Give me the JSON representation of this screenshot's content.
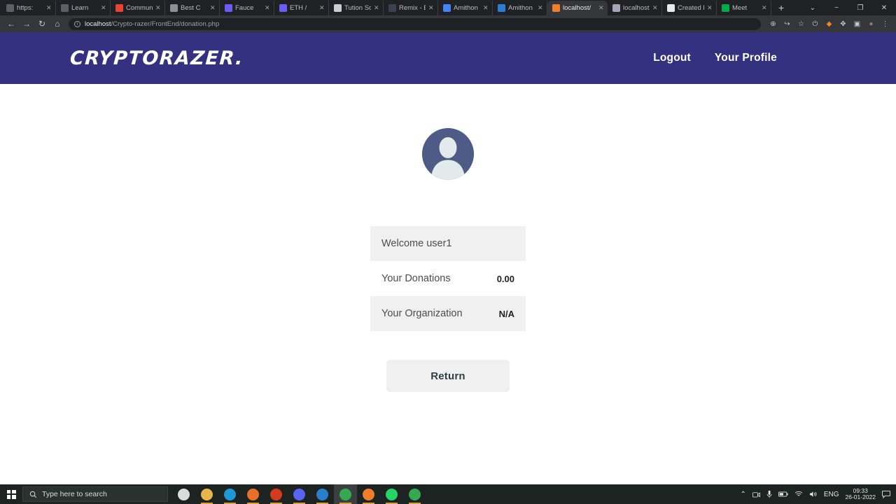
{
  "browser": {
    "tabs": [
      {
        "title": "https:",
        "favicon": "accessibility-icon",
        "color": "#5b6068",
        "active": false
      },
      {
        "title": "Learn",
        "favicon": "accessibility-icon",
        "color": "#5b6068",
        "active": false
      },
      {
        "title": "Communi",
        "favicon": "gmail-icon",
        "color": "#ea4335",
        "active": false
      },
      {
        "title": "Best C",
        "favicon": "metamask-icon",
        "color": "#8a8f98",
        "active": false
      },
      {
        "title": "Fauce",
        "favicon": "ethereum-icon",
        "color": "#6b5cf6",
        "active": false
      },
      {
        "title": "ETH /",
        "favicon": "ethereum-icon",
        "color": "#6b5cf6",
        "active": false
      },
      {
        "title": "Tution Sc",
        "favicon": "shield-icon",
        "color": "#c9cdd4",
        "active": false
      },
      {
        "title": "Remix - E",
        "favicon": "remix-icon",
        "color": "#3b4252",
        "active": false
      },
      {
        "title": "Amithon",
        "favicon": "docs-icon",
        "color": "#4285f4",
        "active": false
      },
      {
        "title": "Amithon",
        "favicon": "drive-doc-icon",
        "color": "#2b7cd3",
        "active": false
      },
      {
        "title": "localhost/",
        "favicon": "xampp-icon",
        "color": "#f07d2c",
        "active": true
      },
      {
        "title": "localhost",
        "favicon": "mysql-icon",
        "color": "#a9a2b8",
        "active": false
      },
      {
        "title": "Created F",
        "favicon": "github-icon",
        "color": "#e8eaed",
        "active": false
      },
      {
        "title": "Meet",
        "favicon": "meet-icon",
        "color": "#00ac47",
        "active": false
      }
    ],
    "new_tab_label": "+",
    "window_controls": [
      "⌄",
      "−",
      "❐",
      "✕"
    ],
    "nav": {
      "back": "←",
      "forward": "→",
      "reload": "↻",
      "home": "⌂"
    },
    "omnibox": {
      "site_info_icon": "info-icon",
      "url_host": "localhost",
      "url_path": "/Crypto-razer/FrontEnd/donation.php",
      "full_url": "localhost/Crypto-razer/FrontEnd/donation.php"
    },
    "toolbar_icons": [
      {
        "name": "zoom-icon",
        "glyph": "⊕"
      },
      {
        "name": "share-icon",
        "glyph": "↪"
      },
      {
        "name": "bookmark-star-icon",
        "glyph": "☆"
      },
      {
        "name": "power-extension-icon",
        "glyph": "⏻"
      },
      {
        "name": "metamask-extension-icon",
        "glyph": "◆"
      },
      {
        "name": "extensions-puzzle-icon",
        "glyph": "✥"
      },
      {
        "name": "sidebar-icon",
        "glyph": "▣"
      },
      {
        "name": "profile-avatar-icon",
        "glyph": "●"
      },
      {
        "name": "chrome-menu-icon",
        "glyph": "⋮"
      }
    ]
  },
  "site": {
    "brand": "CRYPTORAZER.",
    "header_bg": "#333180",
    "nav": [
      {
        "label": "Logout"
      },
      {
        "label": "Your Profile"
      }
    ]
  },
  "profile": {
    "avatar_alt": "user-avatar",
    "rows": [
      {
        "label": "Welcome user1",
        "value": "",
        "shaded": true
      },
      {
        "label": "Your Donations",
        "value": "0.00",
        "shaded": false
      },
      {
        "label": "Your Organization",
        "value": "N/A",
        "shaded": true
      }
    ],
    "return_button": "Return"
  },
  "taskbar": {
    "start_icon": "windows-start-icon",
    "search_placeholder": "Type here to search",
    "search_icon": "search-icon",
    "apps": [
      {
        "name": "task-view-icon",
        "color": "#d9dcda",
        "glyph": "▤",
        "active": false
      },
      {
        "name": "file-explorer-icon",
        "color": "#e8b44c",
        "glyph": "▤",
        "active": false
      },
      {
        "name": "microsoft-edge-icon",
        "color": "#1d9ad6",
        "glyph": "e",
        "active": false
      },
      {
        "name": "firefox-icon",
        "color": "#e8702a",
        "glyph": "◔",
        "active": false
      },
      {
        "name": "brave-browser-icon",
        "color": "#d33a1e",
        "glyph": "▼",
        "active": false
      },
      {
        "name": "discord-icon",
        "color": "#5865f2",
        "glyph": "●",
        "active": false
      },
      {
        "name": "vs-code-icon",
        "color": "#2a7fc9",
        "glyph": "◁",
        "active": false
      },
      {
        "name": "google-chrome-icon",
        "color": "#34a853",
        "glyph": "●",
        "active": true
      },
      {
        "name": "xampp-icon",
        "color": "#f07d2c",
        "glyph": "✖",
        "active": false
      },
      {
        "name": "whatsapp-icon",
        "color": "#25d366",
        "glyph": "✆",
        "active": false
      },
      {
        "name": "google-chrome-icon-2",
        "color": "#34a853",
        "glyph": "●",
        "active": false
      }
    ],
    "tray": {
      "overflow": "⌃",
      "icons": [
        {
          "name": "camera-icon",
          "glyph": "▢"
        },
        {
          "name": "microphone-icon",
          "glyph": "⏺"
        },
        {
          "name": "battery-icon",
          "glyph": "▭"
        },
        {
          "name": "wifi-icon",
          "glyph": "◠"
        },
        {
          "name": "volume-icon",
          "glyph": "◂"
        }
      ],
      "language": "ENG",
      "time": "09:33",
      "date": "26-01-2022",
      "notifications_icon": "notifications-icon"
    }
  }
}
